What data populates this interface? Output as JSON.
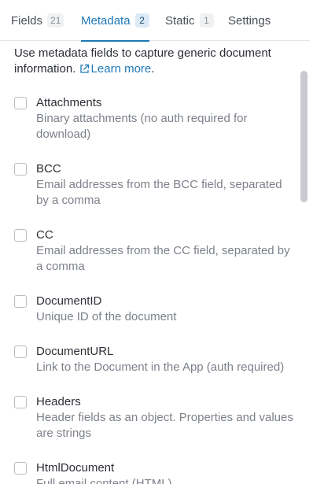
{
  "tabs": [
    {
      "label": "Fields",
      "count": "21"
    },
    {
      "label": "Metadata",
      "count": "2"
    },
    {
      "label": "Static",
      "count": "1"
    },
    {
      "label": "Settings"
    }
  ],
  "intro": {
    "text": "Use metadata fields to capture generic document information.",
    "link_label": "Learn more",
    "suffix": "."
  },
  "fields": [
    {
      "name": "Attachments",
      "description": "Binary attachments (no auth required for download)"
    },
    {
      "name": "BCC",
      "description": "Email addresses from the BCC field, separated by a comma"
    },
    {
      "name": "CC",
      "description": "Email addresses from the CC field, separated by a comma"
    },
    {
      "name": "DocumentID",
      "description": "Unique ID of the document"
    },
    {
      "name": "DocumentURL",
      "description": "Link to the Document in the App (auth required)"
    },
    {
      "name": "Headers",
      "description": "Header fields as an object. Properties and values are strings"
    },
    {
      "name": "HtmlDocument",
      "description": "Full email content (HTML)"
    }
  ],
  "colors": {
    "accent": "#1f78b4",
    "text": "#2c2f36",
    "muted": "#7c818a"
  },
  "icons": {
    "learn_more": "external-link-icon"
  }
}
